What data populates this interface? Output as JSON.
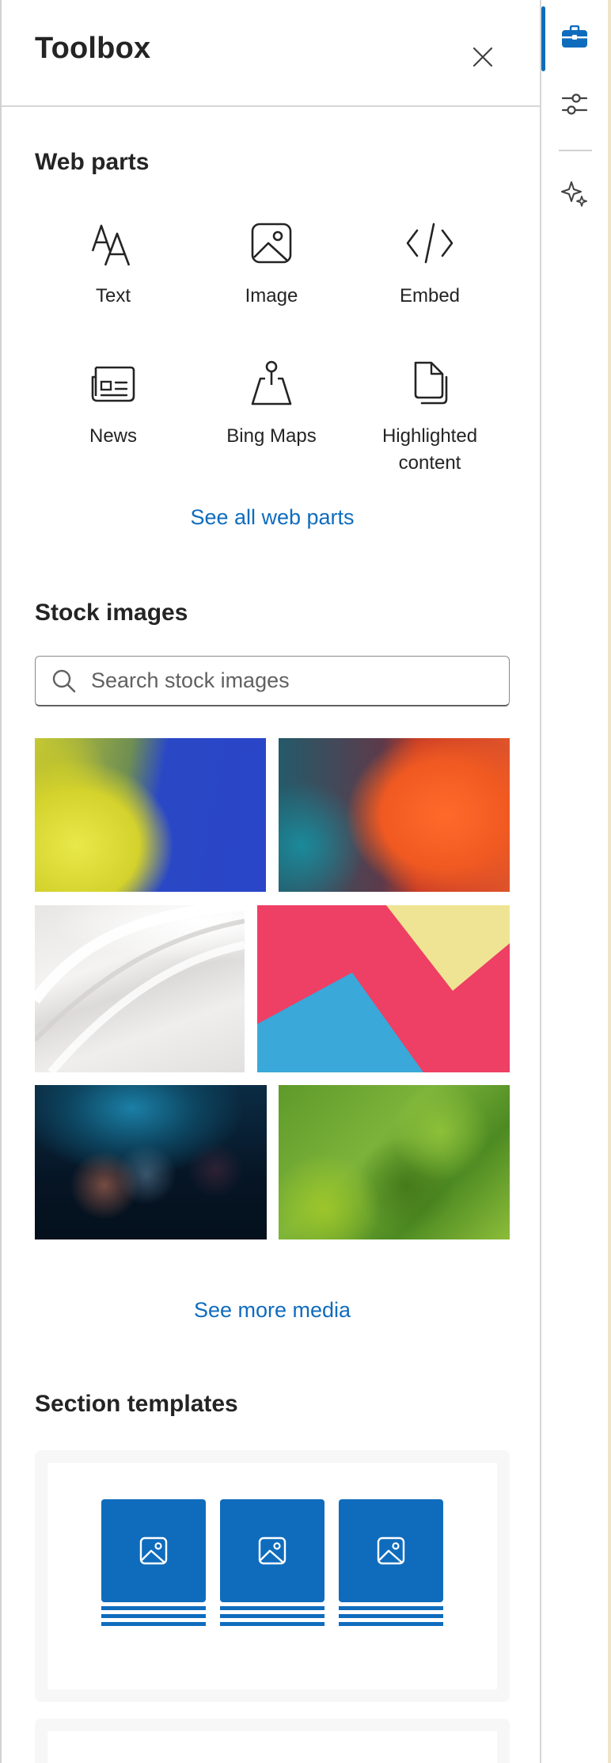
{
  "panel": {
    "title": "Toolbox",
    "close_icon": "close-icon"
  },
  "web_parts": {
    "title": "Web parts",
    "items": [
      {
        "label": "Text",
        "icon": "text-font-icon"
      },
      {
        "label": "Image",
        "icon": "image-icon"
      },
      {
        "label": "Embed",
        "icon": "code-icon"
      },
      {
        "label": "News",
        "icon": "news-icon"
      },
      {
        "label": "Bing Maps",
        "icon": "map-pin-icon"
      },
      {
        "label": "Highlighted content",
        "icon": "document-copy-icon"
      }
    ],
    "see_all_label": "See all web parts"
  },
  "stock_images": {
    "title": "Stock images",
    "search_placeholder": "Search stock images",
    "search_value": "",
    "images": [
      {
        "subject": "yellow and blue powder"
      },
      {
        "subject": "orange and teal powder"
      },
      {
        "subject": "white curved surface"
      },
      {
        "subject": "pink, yellow and blue paper"
      },
      {
        "subject": "dark blue bokeh lights"
      },
      {
        "subject": "green bokeh"
      }
    ],
    "see_more_label": "See more media"
  },
  "section_templates": {
    "title": "Section templates",
    "templates": [
      {
        "kind": "three-column-image-text"
      }
    ]
  },
  "rail": {
    "items": [
      {
        "icon": "toolbox-icon",
        "active": true
      },
      {
        "icon": "settings-sliders-icon",
        "active": false
      },
      {
        "icon": "sparkle-icon",
        "active": false
      }
    ]
  },
  "colors": {
    "accent": "#0f6cbd",
    "text": "#242424",
    "border": "#d1d1d1"
  }
}
